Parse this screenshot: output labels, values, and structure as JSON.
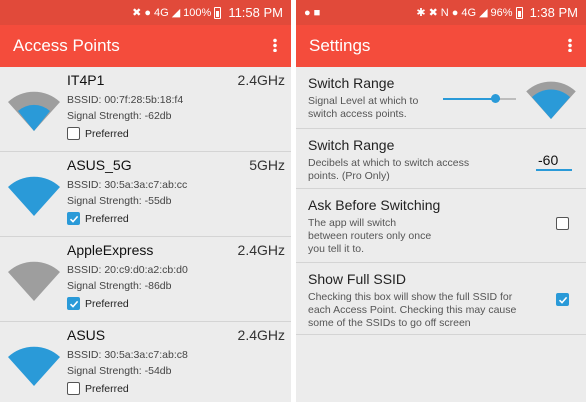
{
  "left": {
    "status": {
      "battery_pct": "100%",
      "time": "11:58 PM",
      "network": "4G"
    },
    "app_title": "Access Points",
    "access_points": [
      {
        "name": "IT4P1",
        "band": "2.4GHz",
        "bssid": "BSSID: 00:7f:28:5b:18:f4",
        "strength": "Signal Strength: -62db",
        "preferred_label": "Preferred",
        "preferred": false,
        "wifi_color": "grey"
      },
      {
        "name": "ASUS_5G",
        "band": "5GHz",
        "bssid": "BSSID: 30:5a:3a:c7:ab:cc",
        "strength": "Signal Strength: -55db",
        "preferred_label": "Preferred",
        "preferred": true,
        "wifi_color": "blue"
      },
      {
        "name": "AppleExpress",
        "band": "2.4GHz",
        "bssid": "BSSID: 20:c9:d0:a2:cb:d0",
        "strength": "Signal Strength: -86db",
        "preferred_label": "Preferred",
        "preferred": true,
        "wifi_color": "grey"
      },
      {
        "name": "ASUS",
        "band": "2.4GHz",
        "bssid": "BSSID: 30:5a:3a:c7:ab:c8",
        "strength": "Signal Strength: -54db",
        "preferred_label": "Preferred",
        "preferred": false,
        "wifi_color": "blue"
      }
    ]
  },
  "right": {
    "status": {
      "battery_pct": "96%",
      "time": "1:38 PM",
      "network": "4G"
    },
    "app_title": "Settings",
    "settings": [
      {
        "title": "Switch Range",
        "desc1": "Signal Level at which to",
        "desc2": "switch access points."
      },
      {
        "title": "Switch Range",
        "desc1": "Decibels at which to switch access",
        "desc2": "points. (Pro Only)",
        "value": "-60"
      },
      {
        "title": "Ask Before Switching",
        "desc1": "The app will switch",
        "desc2": "between routers only once",
        "desc3": "you tell it to.",
        "checked": false
      },
      {
        "title": "Show Full SSID",
        "desc1": "Checking this box will show the full SSID for",
        "desc2": "each Access Point. Checking this may cause",
        "desc3": "some of the SSIDs to go off screen",
        "checked": true
      }
    ]
  },
  "colors": {
    "appbar": "#f44c3c",
    "statusbar": "#e14a3a",
    "accent": "#2a9ad8",
    "wifi_grey": "#9e9e9e"
  }
}
